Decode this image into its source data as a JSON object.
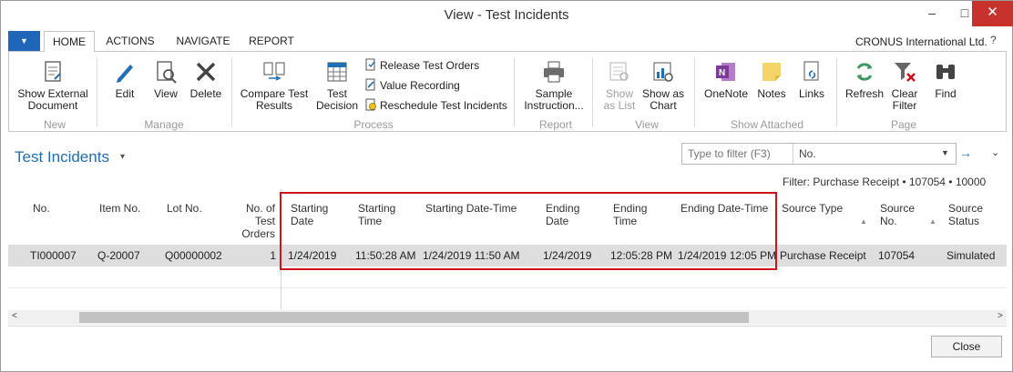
{
  "window": {
    "title": "View - Test Incidents",
    "min_glyph": "‒",
    "max_glyph": "□",
    "close_glyph": "✕"
  },
  "tabs": [
    "HOME",
    "ACTIONS",
    "NAVIGATE",
    "REPORT"
  ],
  "app_menu_glyph": "▼",
  "company": "CRONUS International Ltd.",
  "help_glyph": "?",
  "ribbon": {
    "groups": {
      "new": "New",
      "manage": "Manage",
      "process": "Process",
      "report": "Report",
      "view": "View",
      "show_attached": "Show Attached",
      "page": "Page"
    },
    "show_external_document": "Show External\nDocument",
    "edit": "Edit",
    "view": "View",
    "delete": "Delete",
    "compare_test_results": "Compare Test\nResults",
    "test_decision": "Test\nDecision",
    "release_test_orders": "Release Test Orders",
    "value_recording": "Value Recording",
    "reschedule_test_incidents": "Reschedule Test Incidents",
    "sample_instruction": "Sample\nInstruction...",
    "show_as_list": "Show\nas List",
    "show_as_chart": "Show as\nChart",
    "onenote": "OneNote",
    "notes": "Notes",
    "links": "Links",
    "refresh": "Refresh",
    "clear_filter": "Clear\nFilter",
    "find": "Find"
  },
  "page": {
    "title": "Test Incidents",
    "title_caret": "▾",
    "filter_placeholder": "Type to filter (F3)",
    "filter_field": "No.",
    "filter_dropdown_glyph": "▼",
    "filter_go_glyph": "→",
    "collapse_glyph": "⌄",
    "filter_text": "Filter: Purchase Receipt • 107054 • 10000"
  },
  "grid": {
    "headers": {
      "no": "No.",
      "item_no": "Item No.",
      "lot_no": "Lot No.",
      "no_of_test_orders": "No. of\nTest\nOrders",
      "starting_date": "Starting\nDate",
      "starting_time": "Starting\nTime",
      "starting_date_time": "Starting Date-Time",
      "ending_date": "Ending\nDate",
      "ending_time": "Ending\nTime",
      "ending_date_time": "Ending Date-Time",
      "source_type": "Source Type",
      "source_no": "Source\nNo.",
      "source_status": "Source\nStatus"
    },
    "sort_glyph": "▲",
    "rows": [
      {
        "no": "TI000007",
        "item_no": "Q-20007",
        "lot_no": "Q00000002",
        "no_of_test_orders": "1",
        "starting_date": "1/24/2019",
        "starting_time": "11:50:28 AM",
        "starting_date_time": "1/24/2019 11:50 AM",
        "ending_date": "1/24/2019",
        "ending_time": "12:05:28 PM",
        "ending_date_time": "1/24/2019 12:05 PM",
        "source_type": "Purchase Receipt",
        "source_no": "107054",
        "source_status": "Simulated"
      }
    ]
  },
  "scroll": {
    "left_glyph": "<",
    "right_glyph": ">"
  },
  "close_label": "Close",
  "colors": {
    "accent": "#1f6fb5",
    "highlight": "#d0121b",
    "app_menu": "#1f66b8",
    "close_window": "#c7332c"
  }
}
